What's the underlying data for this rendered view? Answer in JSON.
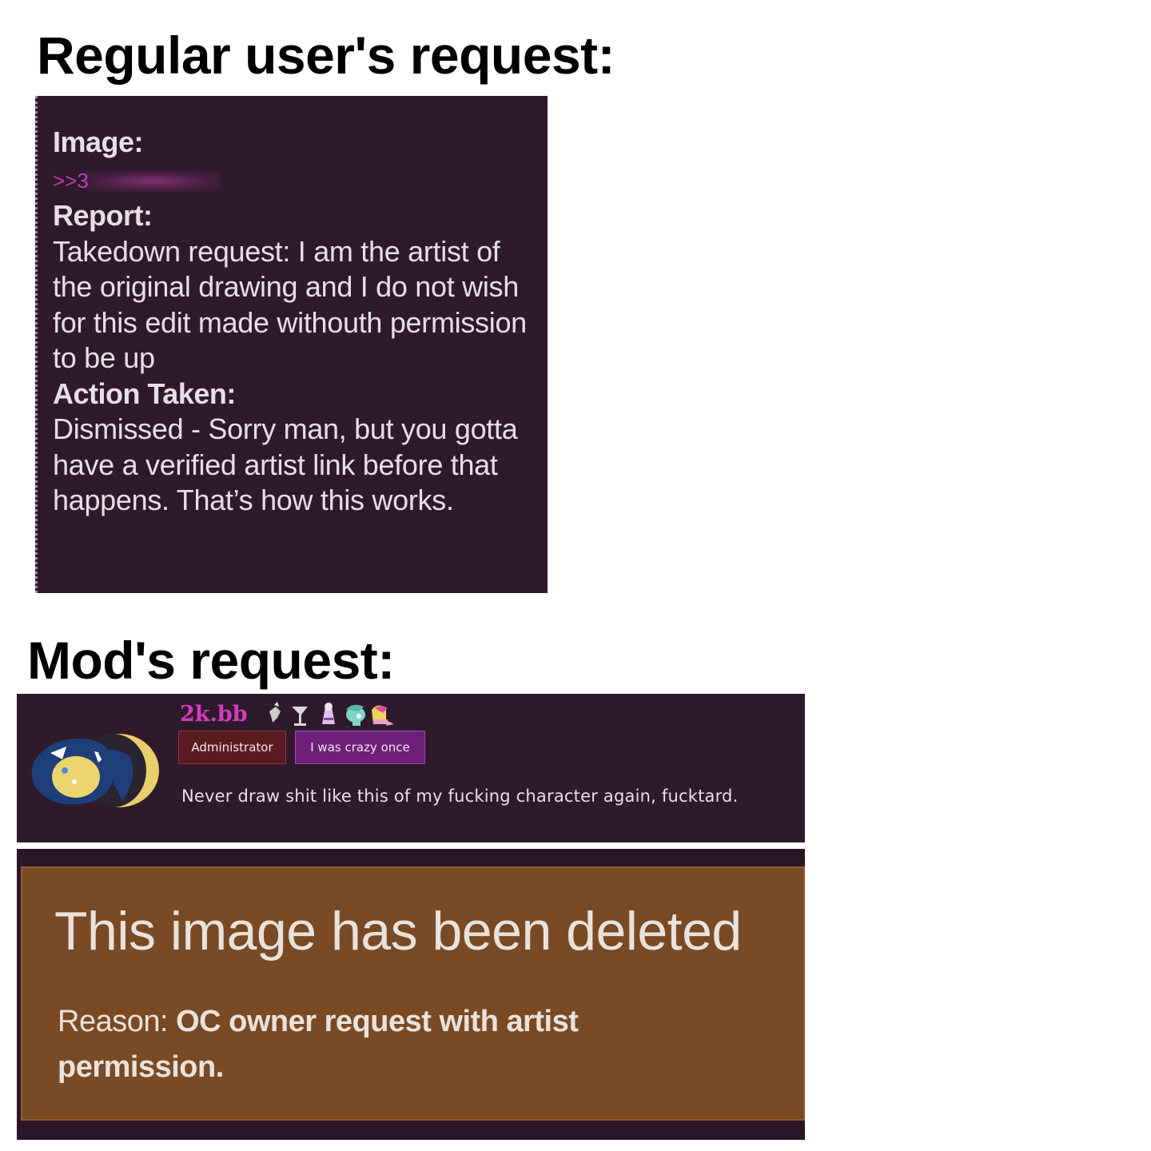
{
  "headings": {
    "regular": "Regular user's request:",
    "mod": "Mod's request:"
  },
  "report": {
    "image_label": "Image:",
    "image_ref": ">>3",
    "report_label": "Report:",
    "report_text": "Takedown request: I am the artist of the original drawing and I do not wish for this edit made withouth permission to be up",
    "action_label": "Action Taken:",
    "action_text": "Dismissed - Sorry man, but you gotta have a verified artist link before that happens. That’s how this works."
  },
  "comment": {
    "username": "2k.bb",
    "badges": [
      "Administrator",
      "I was crazy once"
    ],
    "text": "Never draw shit like this of my fucking character again, fucktard.",
    "icons": [
      "pony-icon",
      "goblet-icon",
      "figure-icon",
      "pony-head-icon",
      "pony-figure-icon"
    ]
  },
  "deleted": {
    "title": "This image has been deleted",
    "reason_label": "Reason: ",
    "reason_text": "OC owner request with artist permission."
  },
  "colors": {
    "panel": "#2f1a2b",
    "accent": "#d23cc0",
    "deleted_bg": "#7a4a24"
  }
}
